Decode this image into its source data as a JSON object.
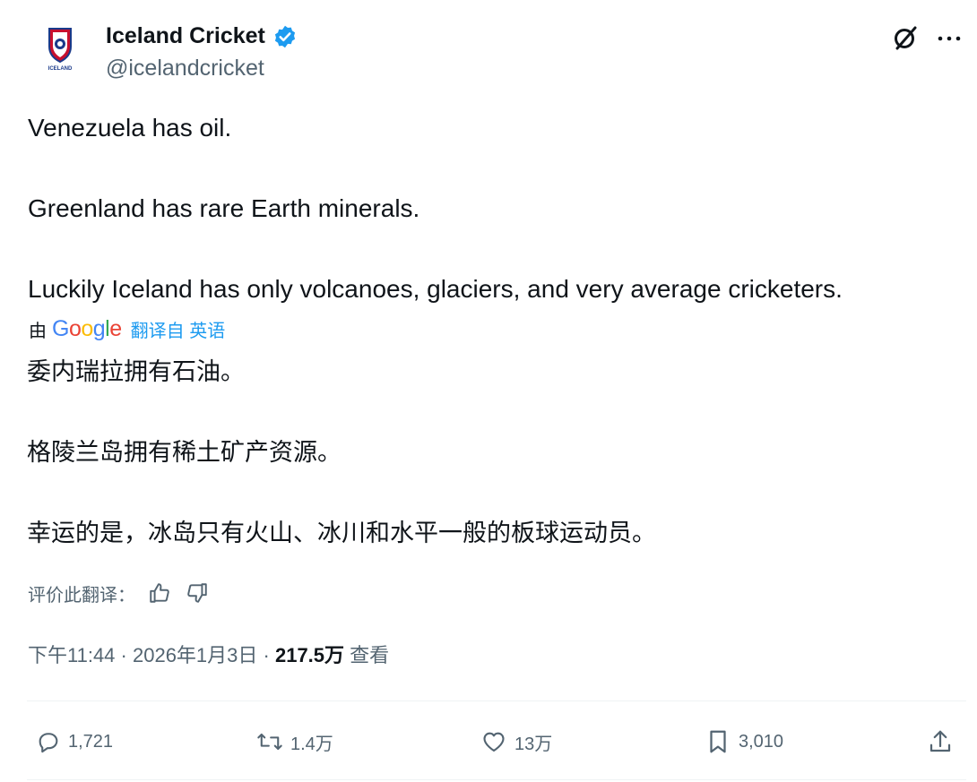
{
  "author": {
    "name": "Iceland Cricket",
    "handle": "@icelandcricket",
    "avatar_text": "ICELAND",
    "verified_icon": "verified-badge-icon"
  },
  "header_icons": [
    "grok-icon",
    "more-icon"
  ],
  "tweet": {
    "paragraphs": [
      "Venezuela has oil.",
      "Greenland has rare Earth minerals.",
      "Luckily Iceland has only volcanoes, glaciers, and very average cricketers."
    ]
  },
  "translation": {
    "by_label": "由",
    "provider": "Google",
    "link_text": "翻译自 英语",
    "paragraphs": [
      "委内瑞拉拥有石油。",
      "格陵兰岛拥有稀土矿产资源。",
      "幸运的是，冰岛只有火山、冰川和水平一般的板球运动员。"
    ],
    "rate_label": "评价此翻译："
  },
  "meta": {
    "time": "下午11:44",
    "separator": " · ",
    "date": "2026年1月3日",
    "views_count": "217.5万",
    "views_label": " 查看"
  },
  "actions": {
    "reply": "1,721",
    "retweet": "1.4万",
    "like": "13万",
    "bookmark": "3,010"
  },
  "colors": {
    "accent": "#1d9bf0",
    "text": "#0f1419",
    "secondary": "#536471"
  }
}
